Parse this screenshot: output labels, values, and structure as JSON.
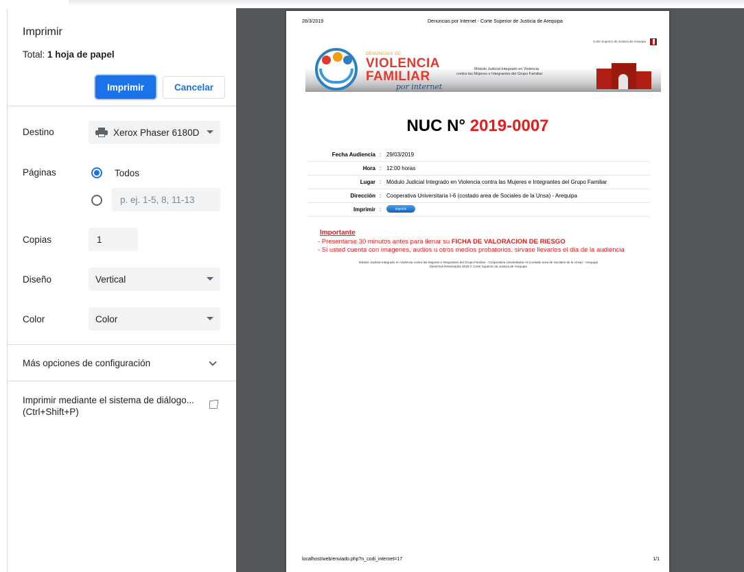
{
  "dialog": {
    "title": "Imprimir",
    "total_prefix": "Total:",
    "total_value": "1 hoja de papel",
    "print_button": "Imprimir",
    "cancel_button": "Cancelar"
  },
  "settings": {
    "destination": {
      "label": "Destino",
      "value": "Xerox Phaser 6180D",
      "icon": "printer-icon"
    },
    "pages": {
      "label": "Páginas",
      "option_all": "Todos",
      "option_all_selected": true,
      "custom_placeholder": "p. ej. 1-5, 8, 11-13"
    },
    "copies": {
      "label": "Copias",
      "value": "1"
    },
    "layout": {
      "label": "Diseño",
      "value": "Vertical"
    },
    "color": {
      "label": "Color",
      "value": "Color"
    },
    "more_options": "Más opciones de configuración",
    "system_dialog_line1": "Imprimir mediante el sistema de diálogo...",
    "system_dialog_line2": "(Ctrl+Shift+P)"
  },
  "preview": {
    "header_date": "28/3/2019",
    "header_title": "Denuncias por Internet - Corte Superior de Justicia de Arequipa",
    "banner": {
      "corte": "Corte Superior de Justicia de Arequipa",
      "denuncias_de": "DENUNCIAS DE",
      "violencia": "VIOLENCIA",
      "familiar": "FAMILIAR",
      "por_internet": "por internet",
      "modulo_line1": "Módulo Judicial Integrado en Violencia",
      "modulo_line2": "contra las Mujeres e Integrantes del Grupo Familiar"
    },
    "nuc_label": "NUC N°",
    "nuc_number": "2019-0007",
    "rows": [
      {
        "key": "Fecha Audiencia",
        "value": "29/03/2019"
      },
      {
        "key": "Hora",
        "value": "12:00 horas"
      },
      {
        "key": "Lugar",
        "value": "Módulo Judicial Integrado en Violencia contra las Mujeres e Integrantes del Grupo Familiar"
      },
      {
        "key": "Dirección",
        "value": "Cooperativa Universitaria I-6 (costado area de Sociales de la Unsa) - Arequipa"
      },
      {
        "key": "Imprimir",
        "value": "Imprimir"
      }
    ],
    "separator": ":",
    "important_title": "Importante",
    "important_line1_prefix": "- Presentarse 30 minutos antes para llenar su ",
    "important_line1_bold": "FICHA DE VALORACION DE RIESGO",
    "important_line2": "- Si usted cuenta con imagenes, audios u otros medios probatorios, sirvase llevarlos el día de la audiencia",
    "footnote_line1": "Módulo Judicial Integrado en Violencia contra las Mujeres e Integrantes del Grupo Familiar - Cooperativa Universitaria I-6 (costado area de Sociales de la Unsa) - Arequipa",
    "footnote_line2": "Derechos Reservados 2019 © Corte Superior de Justicia de Arequipa",
    "footer_url": "localhost/web/enviado.php?n_codi_internet=17",
    "footer_page": "1/1"
  },
  "colors": {
    "accent": "#1a73e8",
    "preview_bg": "#525659",
    "brand_red": "#e31c1c"
  }
}
